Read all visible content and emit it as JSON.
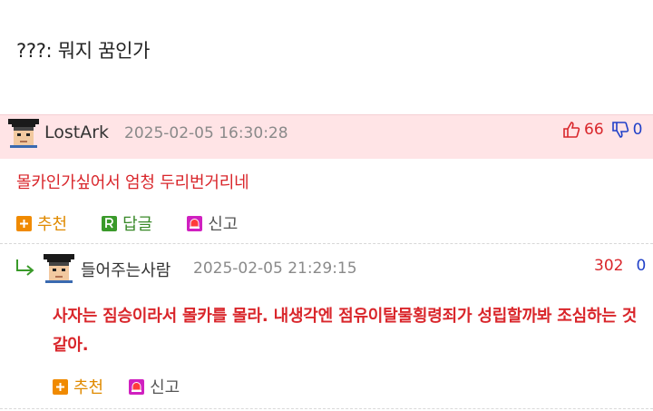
{
  "post": {
    "body": "???: 뭐지 꿈인가"
  },
  "comments": [
    {
      "nick": "LostArk",
      "date": "2025-02-05 16:30:28",
      "up": "66",
      "down": "0",
      "text": "몰카인가싶어서 엄청 두리번거리네",
      "actions": {
        "recommend": "추천",
        "reply": "답글",
        "report": "신고"
      }
    },
    {
      "nick": "들어주는사람",
      "date": "2025-02-05 21:29:15",
      "up": "302",
      "down": "0",
      "text": "사자는 짐승이라서 몰카를 몰라. 내생각엔 점유이탈물횡령죄가 성립할까봐 조심하는 것 같아.",
      "actions": {
        "recommend": "추천",
        "report": "신고"
      }
    }
  ],
  "colors": {
    "accent_red": "#d9262b",
    "accent_blue": "#2040c8",
    "highlight_bg": "#ffe4e6",
    "recommend_orange": "#f08a00",
    "reply_green": "#3a9a2a",
    "report_magenta": "#d020c0"
  },
  "icons": [
    "thumbs-up-icon",
    "thumbs-down-icon",
    "plus-icon",
    "reply-r-icon",
    "siren-icon",
    "reply-arrow-icon",
    "avatar-icon"
  ]
}
